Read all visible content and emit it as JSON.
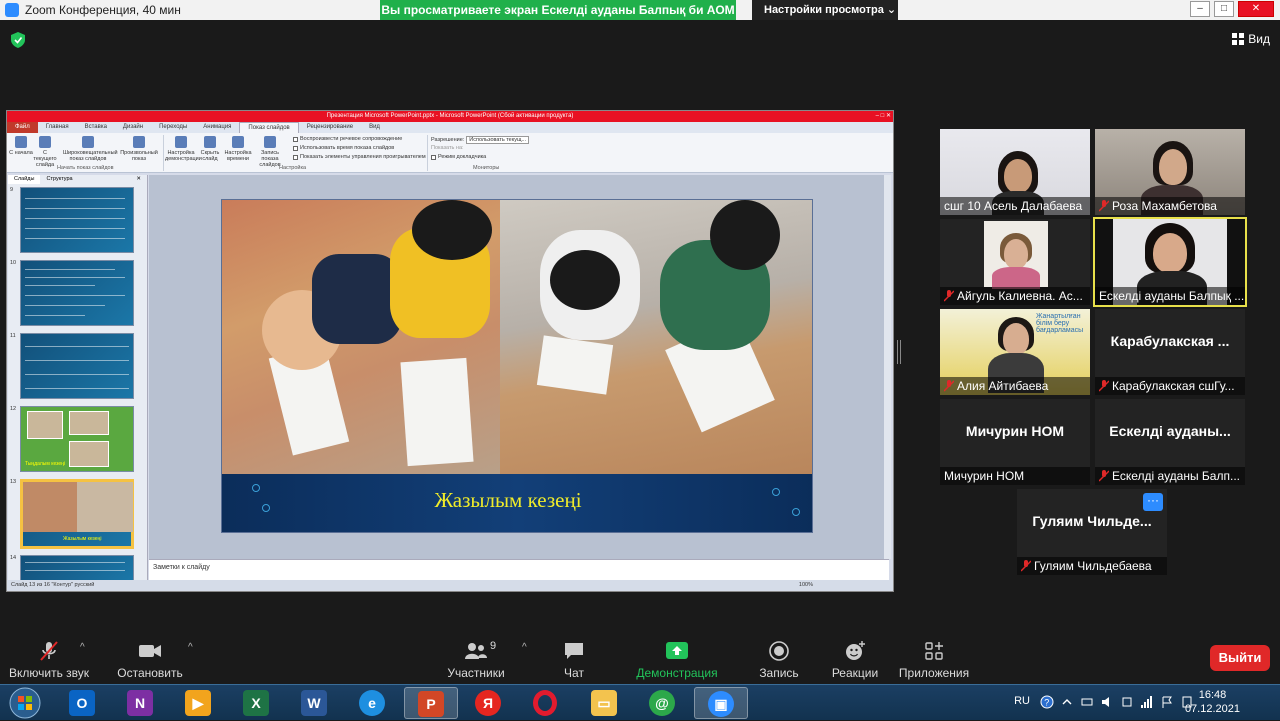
{
  "window": {
    "title": "Zoom Конференция, 40 мин",
    "share_banner": "Вы просматриваете экран Ескелді ауданы Балпық би АОМ",
    "view_settings": "Настройки просмотра",
    "view_label": "Вид"
  },
  "powerpoint": {
    "title": "Презентация Microsoft PowerPoint.pptx - Microsoft PowerPoint (Сбой активации продукта)",
    "tabs": [
      "Файл",
      "Главная",
      "Вставка",
      "Дизайн",
      "Переходы",
      "Анимация",
      "Показ слайдов",
      "Рецензирование",
      "Вид"
    ],
    "ribbon": {
      "buttons": [
        "С начала",
        "С текущего слайда",
        "Широковещательный показ слайдов",
        "Произвольный показ",
        "Настройка демонстрации",
        "Скрыть слайд",
        "Настройка времени",
        "Запись показа слайдов"
      ],
      "checks": [
        "Воспроизвести речевое сопровождение",
        "Использовать время показа слайдов",
        "Показать элементы управления проигрывателем"
      ],
      "resolution_label": "Разрешение:",
      "resolution_value": "Использовать текущ...",
      "show_on_label": "Показать на:",
      "presenter_view": "Режим докладчика",
      "groups": [
        "Начать показ слайдов",
        "Настройка",
        "Мониторы"
      ]
    },
    "left_tabs": [
      "Слайды",
      "Структура"
    ],
    "thumb_numbers": [
      "9",
      "10",
      "11",
      "12",
      "13",
      "14"
    ],
    "thumb_12_caption": "Тыңдалым кезеңі",
    "thumb_13_caption": "Жазылым кезеңі",
    "slide_caption": "Жазылым кезеңі",
    "notes_placeholder": "Заметки к слайду",
    "status": "Слайд 13 из 16   \"Контур\"   русский",
    "zoom": "100%"
  },
  "participants": [
    {
      "name": "сшг 10 Асель Далабаева",
      "muted": false
    },
    {
      "name": "Роза Махамбетова",
      "muted": true
    },
    {
      "name": "Айгуль Калиевна. Ас...",
      "muted": true
    },
    {
      "name": "Ескелді ауданы Балпық ...",
      "muted": false
    },
    {
      "name": "Алия Айтибаева",
      "muted": true
    },
    {
      "name": "Карабулакская сшГу...",
      "big": "Карабулакская ...",
      "muted": true
    },
    {
      "name": "Мичурин НОМ",
      "big": "Мичурин НОМ",
      "muted": false
    },
    {
      "name": "Ескелді ауданы Балп...",
      "big": "Ескелді ауданы...",
      "muted": true
    },
    {
      "name": "Гуляим Чильдебаева",
      "big": "Гуляим  Чильде...",
      "muted": true
    }
  ],
  "toolbar": {
    "unmute": "Включить звук",
    "stop_video": "Остановить видео",
    "participants": "Участники",
    "participants_count": "9",
    "chat": "Чат",
    "share": "Демонстрация экрана",
    "record": "Запись",
    "reactions": "Реакции",
    "apps": "Приложения",
    "leave": "Выйти"
  },
  "taskbar": {
    "lang": "RU",
    "time": "16:48",
    "date": "07.12.2021"
  }
}
